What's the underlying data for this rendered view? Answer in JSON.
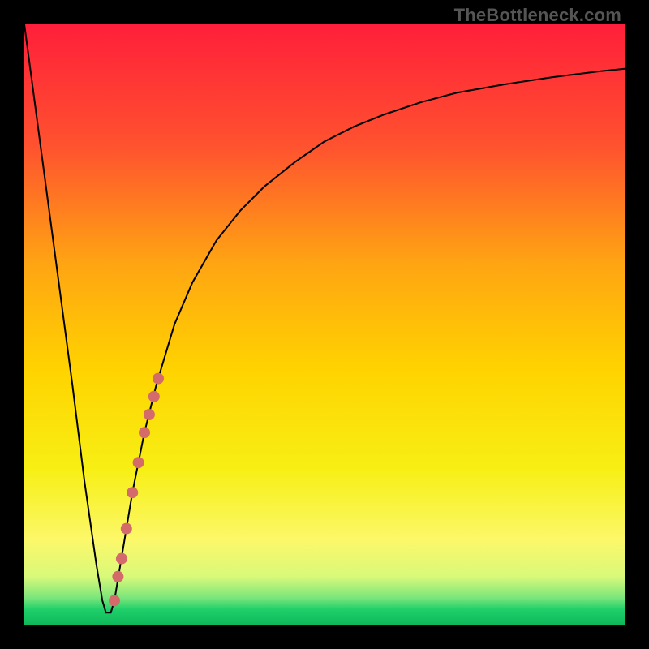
{
  "watermark": "TheBottleneck.com",
  "chart_data": {
    "type": "line",
    "title": "",
    "xlabel": "",
    "ylabel": "",
    "xlim": [
      0,
      100
    ],
    "ylim": [
      0,
      100
    ],
    "grid": false,
    "legend": false,
    "series": [
      {
        "name": "curve",
        "x": [
          0,
          4,
          8,
          10,
          12,
          13,
          13.6,
          14.4,
          15,
          16,
          18,
          20,
          22,
          25,
          28,
          32,
          36,
          40,
          45,
          50,
          55,
          60,
          66,
          72,
          80,
          88,
          96,
          100
        ],
        "y": [
          100,
          70,
          40,
          24,
          10,
          4,
          2,
          2,
          4,
          10,
          22,
          32,
          40,
          50,
          57,
          64,
          69,
          73,
          77,
          80.5,
          83,
          85,
          87,
          88.6,
          90,
          91.2,
          92.2,
          92.6
        ],
        "color": "#000000"
      }
    ],
    "scatter_overlay": {
      "name": "highlight-dots",
      "color": "#d46a6a",
      "points": [
        {
          "x": 15.0,
          "y": 4
        },
        {
          "x": 15.6,
          "y": 8
        },
        {
          "x": 16.2,
          "y": 11
        },
        {
          "x": 17.0,
          "y": 16
        },
        {
          "x": 18.0,
          "y": 22
        },
        {
          "x": 19.0,
          "y": 27
        },
        {
          "x": 20.0,
          "y": 32
        },
        {
          "x": 20.8,
          "y": 35
        },
        {
          "x": 21.6,
          "y": 38
        },
        {
          "x": 22.3,
          "y": 41
        }
      ]
    },
    "gradient": {
      "stops": [
        {
          "offset": 0.0,
          "color": "#ff1f3a"
        },
        {
          "offset": 0.2,
          "color": "#ff512f"
        },
        {
          "offset": 0.4,
          "color": "#ffa512"
        },
        {
          "offset": 0.58,
          "color": "#ffd400"
        },
        {
          "offset": 0.74,
          "color": "#f7ef14"
        },
        {
          "offset": 0.86,
          "color": "#fcf86a"
        },
        {
          "offset": 0.92,
          "color": "#d9f97a"
        },
        {
          "offset": 0.955,
          "color": "#7be67b"
        },
        {
          "offset": 0.975,
          "color": "#1fcf6a"
        },
        {
          "offset": 1.0,
          "color": "#0fb85a"
        }
      ]
    }
  }
}
